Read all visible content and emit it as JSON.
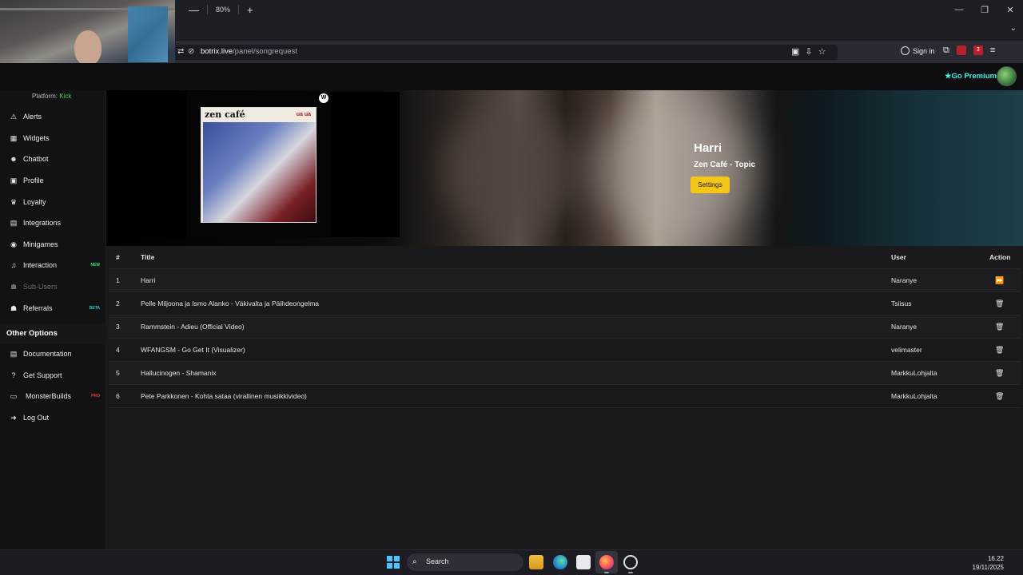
{
  "browser": {
    "zoom": "80%",
    "zoom_minus": "—",
    "zoom_plus": "+",
    "url_domain": "botrix.live",
    "url_path": "/panel/songrequest",
    "sign_in": "Sign in",
    "win_min": "—",
    "win_restore": "❐",
    "win_close": "✕",
    "list_all": "⌄",
    "ext_badge": "3"
  },
  "header": {
    "go_premium": "★Go Premium"
  },
  "sidebar": {
    "peek_label": "Platform:",
    "peek_value": "Kick",
    "items": [
      {
        "label": "Alerts",
        "icon": "⚠"
      },
      {
        "label": "Widgets",
        "icon": "▦"
      },
      {
        "label": "Chatbot",
        "icon": "☻"
      },
      {
        "label": "Profile",
        "icon": "▣"
      },
      {
        "label": "Loyalty",
        "icon": "♛"
      },
      {
        "label": "Integrations",
        "icon": "▤"
      },
      {
        "label": "Minigames",
        "icon": "◉"
      },
      {
        "label": "Interaction",
        "icon": "♫",
        "tag": "NEW"
      },
      {
        "label": "Sub-Users",
        "icon": "☗"
      },
      {
        "label": "Referrals",
        "icon": "☗",
        "tag": "BETA"
      }
    ],
    "section_title": "Other Options",
    "other_items": [
      {
        "label": "Documentation",
        "icon": "▤"
      },
      {
        "label": "Get Support",
        "icon": "?"
      },
      {
        "label": "MonsterBuilds",
        "icon": "▭",
        "tag": "PRO"
      },
      {
        "label": "Log Out",
        "icon": "➜"
      }
    ]
  },
  "now_playing": {
    "title": "Harri",
    "artist": "Zen Café - Topic",
    "settings_label": "Settings",
    "cover_brand": "zen café",
    "cover_tag": "ua ua",
    "label_logo": "W"
  },
  "queue": {
    "columns": [
      "#",
      "Title",
      "User",
      "Action"
    ],
    "rows": [
      {
        "num": "1",
        "title": "Harri",
        "user": "Naranye",
        "action": "⏩"
      },
      {
        "num": "2",
        "title": "Pelle Miljoona ja Ismo Alanko - Väkivalta ja Päihdeongelma",
        "user": "Tsiisus",
        "action": "🗑"
      },
      {
        "num": "3",
        "title": "Rammstein - Adieu (Official Video)",
        "user": "Naranye",
        "action": "🗑"
      },
      {
        "num": "4",
        "title": "WFANGSM - Go Get It (Visualizer)",
        "user": "velimaster",
        "action": "🗑"
      },
      {
        "num": "5",
        "title": "Hallucinogen - Shamanix",
        "user": "MarkkuLohjalta",
        "action": "🗑"
      },
      {
        "num": "6",
        "title": "Pete Parkkonen - Kohta sataa (virallinen musiikkivideo)",
        "user": "MarkkuLohjalta",
        "action": "🗑"
      }
    ]
  },
  "taskbar": {
    "search_label": "Search",
    "time": "16.22",
    "date": "19/11/2025"
  }
}
